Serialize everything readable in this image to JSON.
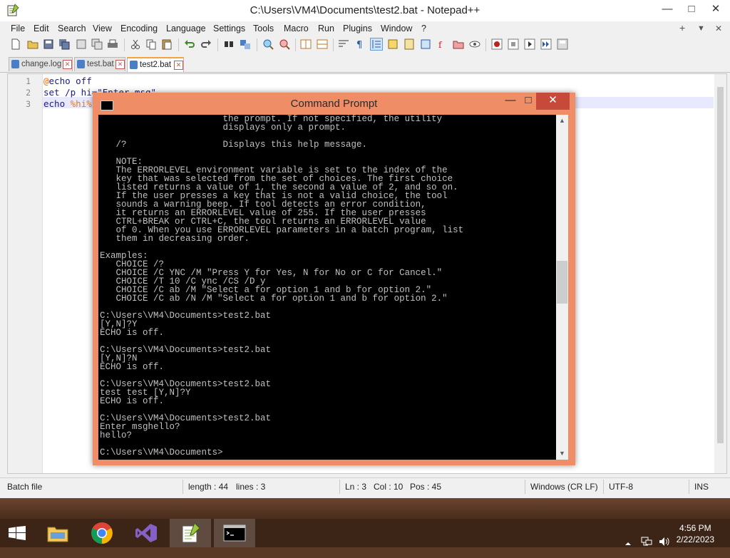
{
  "window": {
    "title": "C:\\Users\\VM4\\Documents\\test2.bat - Notepad++",
    "minimize": "—",
    "maximize": "□",
    "close": "✕"
  },
  "menu": {
    "items": [
      "File",
      "Edit",
      "Search",
      "View",
      "Encoding",
      "Language",
      "Settings",
      "Tools",
      "Macro",
      "Run",
      "Plugins",
      "Window",
      "?"
    ],
    "right": [
      "+",
      "▼",
      "✕"
    ]
  },
  "tabs": [
    {
      "label": "change.log",
      "active": false
    },
    {
      "label": "test.bat",
      "active": false
    },
    {
      "label": "test2.bat",
      "active": true
    }
  ],
  "editor": {
    "lines": [
      {
        "num": "1",
        "parts": [
          {
            "t": "@",
            "c": "at"
          },
          {
            "t": "echo off",
            "c": ""
          }
        ]
      },
      {
        "num": "2",
        "parts": [
          {
            "t": "set /p hi=\"Enter msg\"",
            "c": ""
          }
        ]
      },
      {
        "num": "3",
        "parts": [
          {
            "t": "echo ",
            "c": ""
          },
          {
            "t": "%hi%",
            "c": "var"
          }
        ]
      }
    ]
  },
  "status": {
    "filetype": "Batch file",
    "length": "length : 44",
    "lines": "lines : 3",
    "ln": "Ln : 3",
    "col": "Col : 10",
    "pos": "Pos : 45",
    "eol": "Windows (CR LF)",
    "encoding": "UTF-8",
    "mode": "INS"
  },
  "cmd": {
    "title": "Command Prompt",
    "minimize": "—",
    "maximize": "□",
    "close": "✕",
    "output": "                       the prompt. If not specified, the utility\n                       displays only a prompt.\n\n   /?                  Displays this help message.\n\n   NOTE:\n   The ERRORLEVEL environment variable is set to the index of the\n   key that was selected from the set of choices. The first choice\n   listed returns a value of 1, the second a value of 2, and so on.\n   If the user presses a key that is not a valid choice, the tool\n   sounds a warning beep. If tool detects an error condition,\n   it returns an ERRORLEVEL value of 255. If the user presses\n   CTRL+BREAK or CTRL+C, the tool returns an ERRORLEVEL value\n   of 0. When you use ERRORLEVEL parameters in a batch program, list\n   them in decreasing order.\n\nExamples:\n   CHOICE /?\n   CHOICE /C YNC /M \"Press Y for Yes, N for No or C for Cancel.\"\n   CHOICE /T 10 /C ync /CS /D y\n   CHOICE /C ab /M \"Select a for option 1 and b for option 2.\"\n   CHOICE /C ab /N /M \"Select a for option 1 and b for option 2.\"\n\nC:\\Users\\VM4\\Documents>test2.bat\n[Y,N]?Y\nECHO is off.\n\nC:\\Users\\VM4\\Documents>test2.bat\n[Y,N]?N\nECHO is off.\n\nC:\\Users\\VM4\\Documents>test2.bat\ntest test [Y,N]?Y\nECHO is off.\n\nC:\\Users\\VM4\\Documents>test2.bat\nEnter msghello?\nhello?\n\nC:\\Users\\VM4\\Documents>"
  },
  "taskbar": {
    "apps": [
      {
        "name": "file-explorer",
        "icon": "folder-icon"
      },
      {
        "name": "chrome",
        "icon": "chrome-icon"
      },
      {
        "name": "visual-studio",
        "icon": "visual-studio-icon"
      },
      {
        "name": "notepad-plus-plus",
        "icon": "notepadpp-icon"
      },
      {
        "name": "command-prompt",
        "icon": "cmd-icon"
      }
    ],
    "time": "4:56 PM",
    "date": "2/22/2023"
  },
  "colors": {
    "cmd_frame": "#ef8d67",
    "cmd_close": "#c7493a",
    "tab_accent": "#f3a43a",
    "taskbar": "#3c2416"
  }
}
